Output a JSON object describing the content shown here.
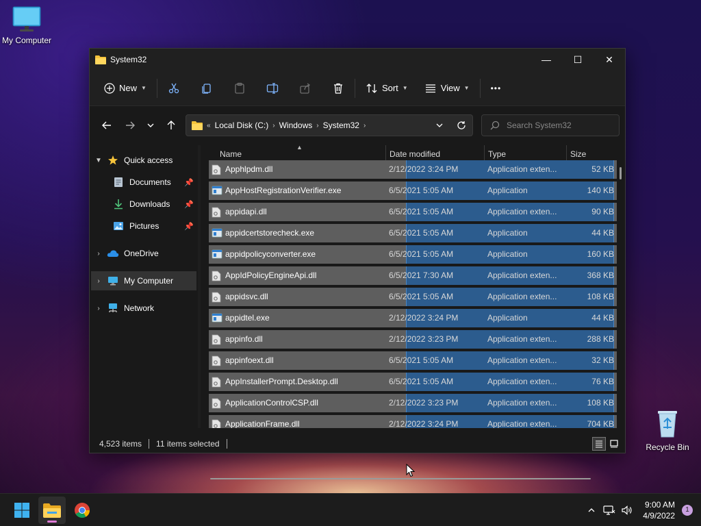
{
  "desktop": {
    "my_computer_label": "My Computer",
    "recycle_bin_label": "Recycle Bin"
  },
  "window": {
    "title": "System32",
    "controls": {
      "minimize": "—",
      "maximize": "☐",
      "close": "✕"
    }
  },
  "toolbar": {
    "new_label": "New",
    "sort_label": "Sort",
    "view_label": "View",
    "more_label": "•••"
  },
  "address": {
    "overflow": "«",
    "crumbs": [
      "Local Disk (C:)",
      "Windows",
      "System32"
    ],
    "separator": "›"
  },
  "search": {
    "placeholder": "Search System32"
  },
  "nav": {
    "quick_access": "Quick access",
    "documents": "Documents",
    "downloads": "Downloads",
    "pictures": "Pictures",
    "onedrive": "OneDrive",
    "my_computer": "My Computer",
    "network": "Network"
  },
  "columns": {
    "name": "Name",
    "date": "Date modified",
    "type": "Type",
    "size": "Size"
  },
  "files": [
    {
      "name": "Apphlpdm.dll",
      "date": "2/12/2022 3:24 PM",
      "type": "Application exten...",
      "size": "52 KB",
      "icon": "dll"
    },
    {
      "name": "AppHostRegistrationVerifier.exe",
      "date": "6/5/2021 5:05 AM",
      "type": "Application",
      "size": "140 KB",
      "icon": "exe"
    },
    {
      "name": "appidapi.dll",
      "date": "6/5/2021 5:05 AM",
      "type": "Application exten...",
      "size": "90 KB",
      "icon": "dll"
    },
    {
      "name": "appidcertstorecheck.exe",
      "date": "6/5/2021 5:05 AM",
      "type": "Application",
      "size": "44 KB",
      "icon": "exe"
    },
    {
      "name": "appidpolicyconverter.exe",
      "date": "6/5/2021 5:05 AM",
      "type": "Application",
      "size": "160 KB",
      "icon": "exe"
    },
    {
      "name": "AppIdPolicyEngineApi.dll",
      "date": "6/5/2021 7:30 AM",
      "type": "Application exten...",
      "size": "368 KB",
      "icon": "dll"
    },
    {
      "name": "appidsvc.dll",
      "date": "6/5/2021 5:05 AM",
      "type": "Application exten...",
      "size": "108 KB",
      "icon": "dll"
    },
    {
      "name": "appidtel.exe",
      "date": "2/12/2022 3:24 PM",
      "type": "Application",
      "size": "44 KB",
      "icon": "exe"
    },
    {
      "name": "appinfo.dll",
      "date": "2/12/2022 3:23 PM",
      "type": "Application exten...",
      "size": "288 KB",
      "icon": "dll"
    },
    {
      "name": "appinfoext.dll",
      "date": "6/5/2021 5:05 AM",
      "type": "Application exten...",
      "size": "32 KB",
      "icon": "dll"
    },
    {
      "name": "AppInstallerPrompt.Desktop.dll",
      "date": "6/5/2021 5:05 AM",
      "type": "Application exten...",
      "size": "76 KB",
      "icon": "dll"
    },
    {
      "name": "ApplicationControlCSP.dll",
      "date": "2/12/2022 3:23 PM",
      "type": "Application exten...",
      "size": "108 KB",
      "icon": "dll"
    },
    {
      "name": "ApplicationFrame.dll",
      "date": "2/12/2022 3:24 PM",
      "type": "Application exten...",
      "size": "704 KB",
      "icon": "dll"
    }
  ],
  "status": {
    "item_count": "4,523 items",
    "selected": "11 items selected"
  },
  "taskbar": {
    "time": "9:00 AM",
    "date": "4/9/2022",
    "notification_count": "1"
  }
}
